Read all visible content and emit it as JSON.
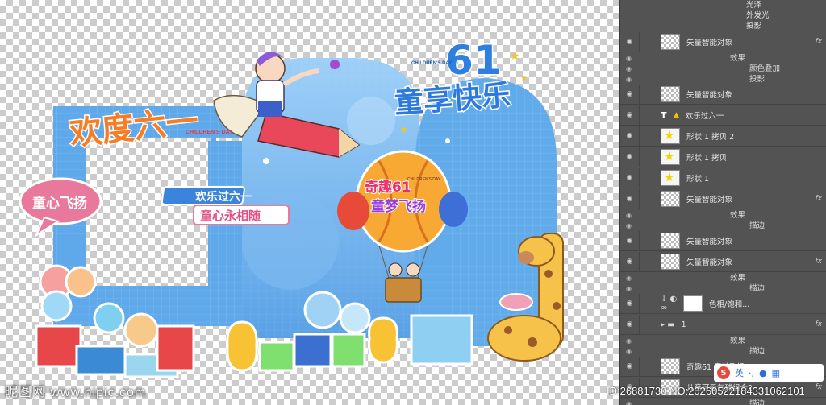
{
  "canvas": {
    "headline_text": "欢度六一",
    "children_day_text": "CHILDREN'S DAY",
    "badge_61": "61",
    "badge_children_day": "CHILDREN'S DAY",
    "badge_main": "童享快乐",
    "bubble_text": "童心飞扬",
    "banner_top": "欢乐过六一",
    "banner_bottom": "童心永相随",
    "balloon_title_line1": "奇趣61",
    "balloon_title_line2": "童梦飞扬",
    "balloon_small": "CHILDREN'S DAY",
    "watermark_left": "昵图网 www.nipic.com",
    "watermark_right": "ID:26881730 NO:20260522184331062101"
  },
  "panel": {
    "effects_top": [
      "光泽",
      "外发光",
      "投影"
    ],
    "layers": [
      {
        "name": "矢量智能对象",
        "fx": "fx",
        "kind": "smart"
      },
      {
        "sub": "效果"
      },
      {
        "sub": "颜色叠加"
      },
      {
        "sub": "投影"
      },
      {
        "name": "矢量智能对象",
        "fx": "",
        "kind": "smart"
      },
      {
        "name": "欢乐过六一",
        "fx": "",
        "kind": "text"
      },
      {
        "name": "形状 1 拷贝 2",
        "fx": "",
        "kind": "shape"
      },
      {
        "name": "形状 1 拷贝",
        "fx": "",
        "kind": "shape"
      },
      {
        "name": "形状 1",
        "fx": "",
        "kind": "shape"
      },
      {
        "name": "矢量智能对象",
        "fx": "fx",
        "kind": "smart"
      },
      {
        "sub": "效果"
      },
      {
        "sub": "描边"
      },
      {
        "name": "矢量智能对象",
        "fx": "",
        "kind": "smart"
      },
      {
        "name": "矢量智能对象",
        "fx": "fx",
        "kind": "smart"
      },
      {
        "sub": "效果"
      },
      {
        "sub": "描边"
      },
      {
        "name": "色相/饱和...",
        "fx": "",
        "kind": "adjust"
      },
      {
        "name": "1",
        "fx": "fx",
        "kind": "folder"
      },
      {
        "sub": "效果"
      },
      {
        "sub": "描边"
      },
      {
        "name": "奇趣61 童梦飞扬",
        "fx": "",
        "kind": "smart"
      },
      {
        "name": "儿童可爱气球组合2",
        "fx": "fx",
        "kind": "smart"
      },
      {
        "sub": "描边"
      }
    ],
    "ime_label": "英"
  }
}
